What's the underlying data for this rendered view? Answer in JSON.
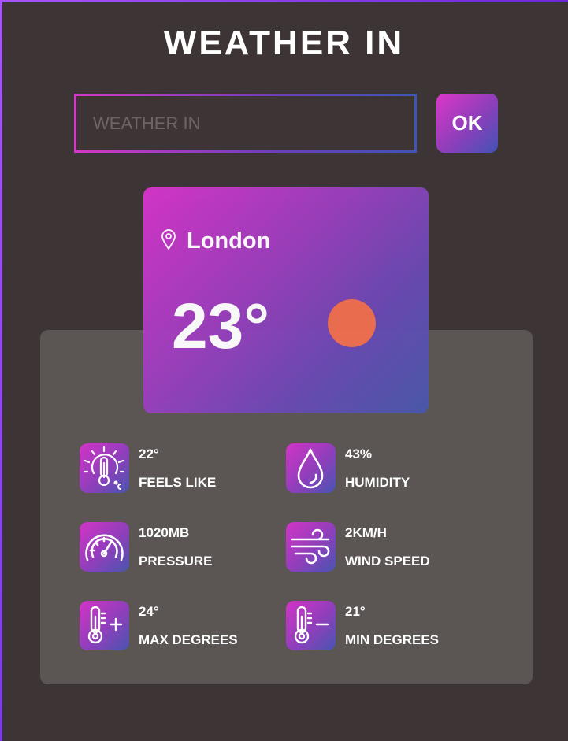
{
  "title": "WEATHER IN",
  "search": {
    "placeholder": "WEATHER IN",
    "value": ""
  },
  "ok_label": "OK",
  "card": {
    "city": "London",
    "temperature": "23°"
  },
  "stats": {
    "feels_like": {
      "value": "22°",
      "label": "FEELS LIKE"
    },
    "humidity": {
      "value": "43%",
      "label": "HUMIDITY"
    },
    "pressure": {
      "value": "1020MB",
      "label": "PRESSURE"
    },
    "wind_speed": {
      "value": "2KM/H",
      "label": "WIND SPEED"
    },
    "max_degrees": {
      "value": "24°",
      "label": "MAX DEGREES"
    },
    "min_degrees": {
      "value": "21°",
      "label": "MIN DEGREES"
    }
  },
  "icons": [
    "location-pin-icon",
    "sun-icon",
    "feels-like-thermometer-icon",
    "humidity-drop-icon",
    "pressure-gauge-icon",
    "wind-icon",
    "thermometer-plus-icon",
    "thermometer-minus-icon"
  ],
  "colors": {
    "background": "#3d3535",
    "panel": "#5b5554",
    "gradient_start": "#d834cb",
    "gradient_end": "#4858ab",
    "sun": "#ef6f4e"
  }
}
